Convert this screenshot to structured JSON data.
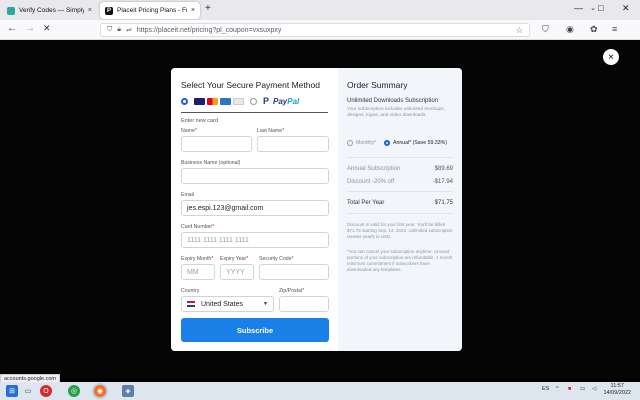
{
  "browser": {
    "tabs": [
      {
        "label": "Verify Codes — SimplyCodes",
        "close": "×",
        "favicon_color": "#2aa8a0"
      },
      {
        "label": "Placeit Pricing Plans - Free Temp",
        "close": "×",
        "favicon_color": "#111111"
      }
    ],
    "new_tab": "+",
    "url": "https://placeit.net/pricing?pl_coupon=vxsuxpxy",
    "window_controls": {
      "minimize": "—",
      "maximize": "□",
      "close": "✕"
    }
  },
  "modal": {
    "close": "×",
    "left": {
      "title": "Select Your Secure Payment Method",
      "paypal": {
        "p": "P",
        "pay": "Pay",
        "pal": "Pal"
      },
      "enter_new_card": "Enter new card",
      "name_label": "Name",
      "lastname_label": "Last Name",
      "required_mark": "*",
      "business_label": "Business Name (optional)",
      "email_label": "Email",
      "email_value": "jes.espi.123@gmail.com",
      "card_label": "Card Number",
      "card_placeholder": "1111 1111 1111 1111",
      "expiry_month_label": "Expiry Month",
      "expiry_month_placeholder": "MM",
      "expiry_year_label": "Expiry Year",
      "expiry_year_placeholder": "YYYY",
      "security_label": "Security Code",
      "country_label": "Country",
      "country_value": "United States",
      "zip_label": "Zip/Postal",
      "subscribe_label": "Subscribe"
    },
    "right": {
      "title": "Order Summary",
      "plan_name": "Unlimited Downloads Subscription",
      "plan_desc": "Your subscription includes unlimited mockups, designs, logos, and video downloads.",
      "monthly_label": "Monthly*",
      "annual_label": "Annual* (Save 59.33%)",
      "annual_sub_label": "Annual Subscription",
      "annual_sub_value": "$89.69",
      "discount_label": "Discount -20% off",
      "discount_value": "-$17.94",
      "total_label": "Total Per Year",
      "total_value": "$71.75",
      "note1": "Discount is valid for your first year. You'll be billed $71.75 starting Sep. 14, 2022. Unlimited subscription renews yearly in USD.",
      "note2": "*You can cancel your subscription anytime. Unused portions of your subscription are refundable. 1 month minimum commitment if subscribers have downloaded any templates."
    }
  },
  "status": {
    "text": "accounts.google.com"
  },
  "taskbar": {
    "lang": "ES",
    "time": "11:57",
    "date": "14/09/2022"
  }
}
